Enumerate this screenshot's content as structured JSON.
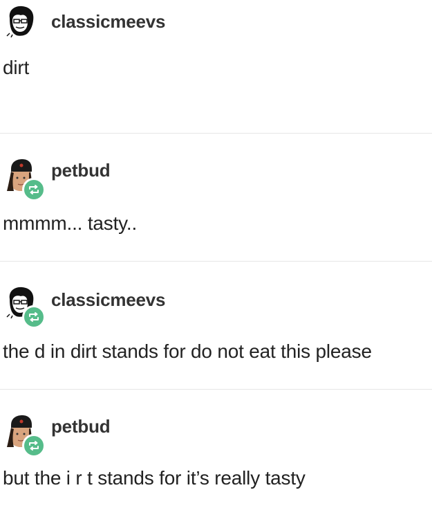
{
  "posts": [
    {
      "username": "classicmeevs",
      "text": "dirt",
      "avatar": "cartoon-face-avatar",
      "reblogged": false
    },
    {
      "username": "petbud",
      "text": "mmmm... tasty..",
      "avatar": "fur-hat-avatar",
      "reblogged": true
    },
    {
      "username": "classicmeevs",
      "text": "the d in dirt stands for do not eat this please",
      "avatar": "cartoon-face-avatar",
      "reblogged": true
    },
    {
      "username": "petbud",
      "text": "but the i r t stands for it’s really tasty",
      "avatar": "fur-hat-avatar",
      "reblogged": true
    }
  ],
  "colors": {
    "reblog_badge": "#56bc8a",
    "divider": "#e6e6e6"
  },
  "icons": {
    "reblog": "reblog-icon"
  }
}
